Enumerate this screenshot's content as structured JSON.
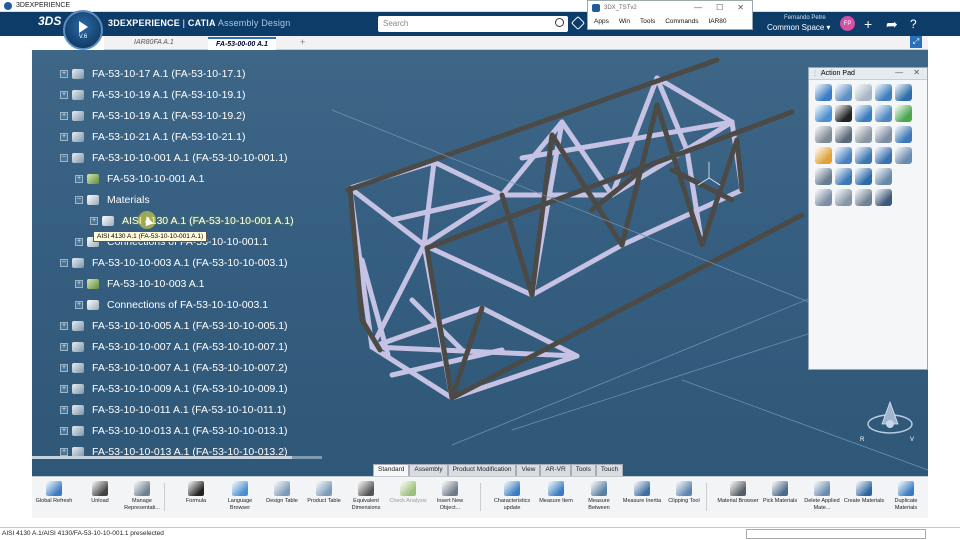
{
  "os_window": {
    "title": "3DEXPERIENCE",
    "controls": [
      "—",
      "☐",
      "✕"
    ]
  },
  "header": {
    "brand": "3DS",
    "compass_version": "V.6",
    "title_strong": "3DEXPERIENCE",
    "title_sep": " | ",
    "title_app": "CATIA",
    "title_module": " Assembly Design",
    "search_placeholder": "Search",
    "user_name": "Fernando Petre",
    "space": "Common Space",
    "avatar_initials": "FP",
    "icons": [
      "tag-icon",
      "plus-icon",
      "share-icon",
      "compass-icon",
      "help-icon"
    ]
  },
  "mini_window": {
    "title": "3DX_TSTv2",
    "controls": [
      "—",
      "☐",
      "✕"
    ],
    "menu": [
      "Apps",
      "Win",
      "Tools",
      "Commands",
      "IAR80"
    ]
  },
  "tabs": [
    {
      "label": "IAR80FA A.1",
      "active": false
    },
    {
      "label": "FA-53-00-00 A.1",
      "active": true
    }
  ],
  "tree": [
    {
      "label": "FA-53-10-17 A.1 (FA-53-10-17.1)",
      "indent": 0,
      "icon": "part"
    },
    {
      "label": "FA-53-10-19 A.1 (FA-53-10-19.1)",
      "indent": 0,
      "icon": "part"
    },
    {
      "label": "FA-53-10-19 A.1 (FA-53-10-19.2)",
      "indent": 0,
      "icon": "part"
    },
    {
      "label": "FA-53-10-21 A.1 (FA-53-10-21.1)",
      "indent": 0,
      "icon": "part"
    },
    {
      "label": "FA-53-10-10-001 A.1 (FA-53-10-10-001.1)",
      "indent": 0,
      "icon": "product",
      "expanded": true
    },
    {
      "label": "FA-53-10-10-001 A.1",
      "indent": 1,
      "icon": "green"
    },
    {
      "label": "Materials",
      "indent": 1,
      "icon": "mat",
      "expanded": true
    },
    {
      "label": "AISI 4130 A.1 (FA-53-10-10-001 A.1)",
      "indent": 2,
      "icon": "mat",
      "highlight": true
    },
    {
      "label": "Connections of FA-53-10-10-001.1",
      "indent": 1,
      "icon": "conn"
    },
    {
      "label": "FA-53-10-10-003 A.1 (FA-53-10-10-003.1)",
      "indent": 0,
      "icon": "product",
      "expanded": true
    },
    {
      "label": "FA-53-10-10-003 A.1",
      "indent": 1,
      "icon": "green"
    },
    {
      "label": "Connections of FA-53-10-10-003.1",
      "indent": 1,
      "icon": "conn"
    },
    {
      "label": "FA-53-10-10-005 A.1 (FA-53-10-10-005.1)",
      "indent": 0,
      "icon": "part"
    },
    {
      "label": "FA-53-10-10-007 A.1 (FA-53-10-10-007.1)",
      "indent": 0,
      "icon": "part"
    },
    {
      "label": "FA-53-10-10-007 A.1 (FA-53-10-10-007.2)",
      "indent": 0,
      "icon": "part"
    },
    {
      "label": "FA-53-10-10-009 A.1 (FA-53-10-10-009.1)",
      "indent": 0,
      "icon": "part"
    },
    {
      "label": "FA-53-10-10-011 A.1 (FA-53-10-10-011.1)",
      "indent": 0,
      "icon": "part"
    },
    {
      "label": "FA-53-10-10-013 A.1 (FA-53-10-10-013.1)",
      "indent": 0,
      "icon": "part"
    },
    {
      "label": "FA-53-10-10-013 A.1 (FA-53-10-10-013.2)",
      "indent": 0,
      "icon": "part"
    }
  ],
  "tooltip": "AISI 4130 A.1 (FA-53-10-10-001 A.1)",
  "action_pad": {
    "title": "Action Pad",
    "controls": "— ✕",
    "icon_colors": [
      "#3a7cc2",
      "#5d8ec4",
      "#a8b7c6",
      "#3f7fbf",
      "#2d6ea8",
      "#4a8fd0",
      "#222222",
      "#3b7bc0",
      "#4c87c3",
      "#4ba64f",
      "#7e8a95",
      "#5a6978",
      "#8a96a2",
      "#7d8ea0",
      "#3d79b8",
      "#e0a23a",
      "#4a80c0",
      "#3b76b3",
      "#3a6fb0",
      "#6a8bb0",
      "#6a7d90",
      "#3e77b6",
      "#2d6aa8",
      "#6a88a8",
      "",
      "#7b8ea3",
      "#8796a6",
      "#6f8196",
      "#3d5a7a",
      ""
    ]
  },
  "toolbar_tabs": [
    {
      "label": "Standard",
      "active": true
    },
    {
      "label": "Assembly",
      "active": false
    },
    {
      "label": "Product Modification",
      "active": false
    },
    {
      "label": "View",
      "active": false
    },
    {
      "label": "AR-VR",
      "active": false
    },
    {
      "label": "Tools",
      "active": false
    },
    {
      "label": "Touch",
      "active": false
    }
  ],
  "toolbar": [
    {
      "label": "Global Refresh",
      "color": "#3a7cc2"
    },
    {
      "label": "Unload",
      "color": "#444444"
    },
    {
      "label": "Manage Representati...",
      "color": "#6e7f90"
    },
    {
      "label": "Formula",
      "color": "#222222"
    },
    {
      "label": "Language Browser",
      "color": "#4a90d0"
    },
    {
      "label": "Design Table",
      "color": "#7d9bb8"
    },
    {
      "label": "Product Table",
      "color": "#7d9bb8"
    },
    {
      "label": "Equivalent Dimensions",
      "color": "#555555"
    },
    {
      "label": "Check Analysis",
      "color": "#9bbf7a",
      "disabled": true
    },
    {
      "label": "Insert New Object...",
      "color": "#6d7b88"
    },
    {
      "label": "Characteristics update",
      "color": "#3a7cc2"
    },
    {
      "label": "Measure Item",
      "color": "#3a7cc2"
    },
    {
      "label": "Measure Between",
      "color": "#5b7ea0"
    },
    {
      "label": "Measure Inertia",
      "color": "#3f6fa0"
    },
    {
      "label": "Clipping Tool",
      "color": "#5f86b0"
    },
    {
      "label": "Material Browser",
      "color": "#555e66"
    },
    {
      "label": "Pick Materials",
      "color": "#4a6a8a"
    },
    {
      "label": "Delete Applied Mate...",
      "color": "#6b8bb0"
    },
    {
      "label": "Create Materials",
      "color": "#2e65a0"
    },
    {
      "label": "Duplicate Materials",
      "color": "#3a7cc2"
    }
  ],
  "status": "AISI 4130 A.1/AISI 4130/FA-53-10-10-001.1 preselected",
  "colors": {
    "header": "#0e3c68",
    "viewport": "#3b6385",
    "tube_light": "#c9c5e6",
    "tube_dark": "#4a4a48"
  }
}
